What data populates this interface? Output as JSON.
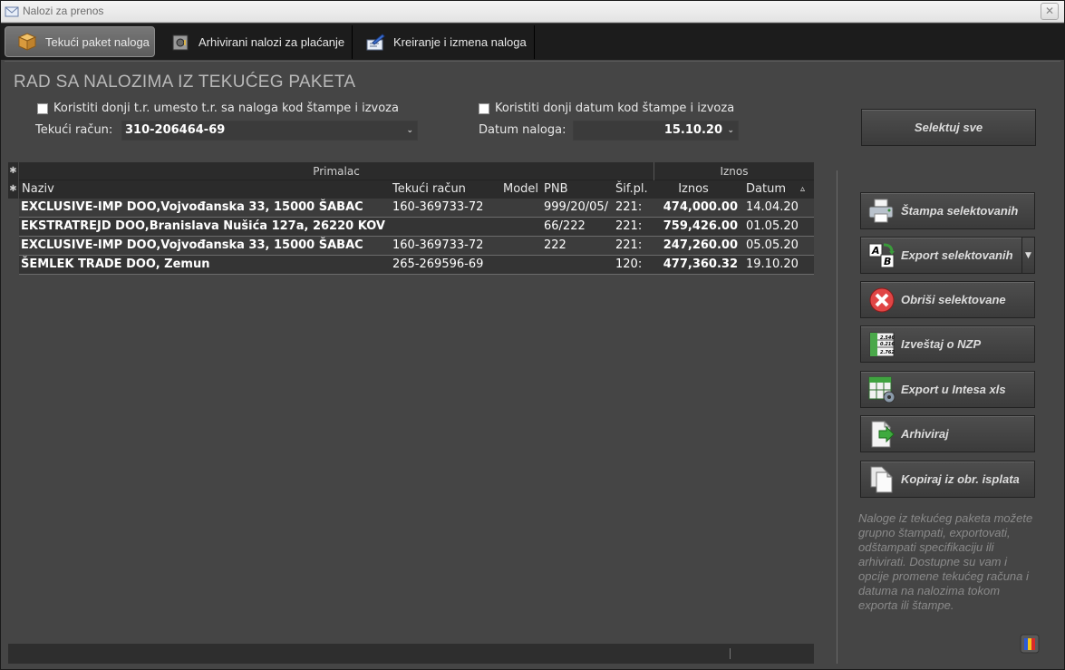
{
  "window": {
    "title": "Nalozi za prenos"
  },
  "tabs": [
    {
      "label": "Tekući paket naloga",
      "icon": "package-icon",
      "active": true
    },
    {
      "label": "Arhivirani nalozi za plaćanje",
      "icon": "safe-icon",
      "active": false
    },
    {
      "label": "Kreiranje i izmena naloga",
      "icon": "pen-edit-icon",
      "active": false
    }
  ],
  "page_title": "RAD SA NALOZIMA IZ TEKUĆEG PAKETA",
  "options": {
    "use_account_label": "Koristiti donji t.r. umesto t.r. sa naloga kod štampe i izvoza",
    "use_account_checked": false,
    "use_date_label": "Koristiti donji datum kod štampe i izvoza",
    "use_date_checked": false,
    "account_label": "Tekući račun:",
    "account_value": "310-206464-69",
    "date_label": "Datum naloga:",
    "date_value": "15.10.20"
  },
  "grid": {
    "band_headers": {
      "primalac": "Primalac",
      "iznos": "Iznos"
    },
    "columns": [
      "Naziv",
      "Tekući račun",
      "Model",
      "PNB",
      "Šif.pl.",
      "Iznos",
      "Datum"
    ],
    "sort_indicator": "▵",
    "rows": [
      {
        "naziv": "EXCLUSIVE-IMP DOO,Vojvođanska 33, 15000 ŠABAC",
        "racun": "160-369733-72",
        "model": "",
        "pnb": "999/20/05/",
        "sif": "221:",
        "iznos": "474,000.00",
        "datum": "14.04.20"
      },
      {
        "naziv": "EKSTRATREJD DOO,Branislavа Nušića 127a, 26220 KOV",
        "racun": "",
        "model": "",
        "pnb": "66/222",
        "sif": "221:",
        "iznos": "759,426.00",
        "datum": "01.05.20"
      },
      {
        "naziv": "EXCLUSIVE-IMP DOO,Vojvođanska 33, 15000 ŠABAC",
        "racun": "160-369733-72",
        "model": "",
        "pnb": "222",
        "sif": "221:",
        "iznos": "247,260.00",
        "datum": "05.05.20"
      },
      {
        "naziv": "ŠEMLEK TRADE DOO, Zemun",
        "racun": "265-269596-69",
        "model": "",
        "pnb": "",
        "sif": "120:",
        "iznos": "477,360.32",
        "datum": "19.10.20"
      }
    ]
  },
  "buttons": {
    "select_all": "Selektuj sve",
    "print_selected": "Štampa selektovanih",
    "export_selected": "Export selektovanih",
    "delete_selected": "Obriši selektovane",
    "report_nzp": "Izveštaj o NZP",
    "export_intesa": "Export u Intesa xls",
    "archive": "Arhiviraj",
    "copy_from": "Kopiraj iz obr. isplata"
  },
  "info_text": "Naloge iz tekućeg paketa možete grupno štampati, exportovati, odštampati specifikaciju ili arhivirati. Dostupne su vam i opcije promene tekućeg računa i datuma na nalozima tokom exporta ili štampe."
}
